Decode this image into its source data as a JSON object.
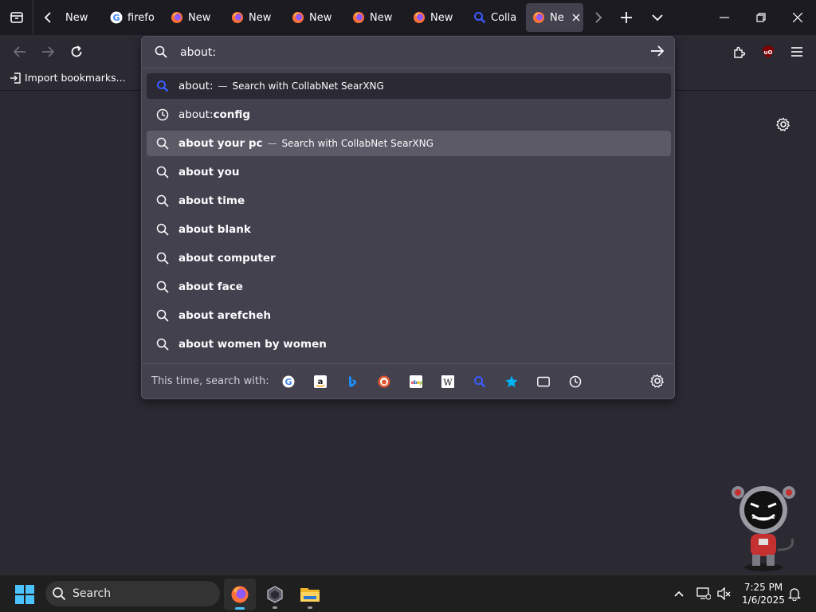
{
  "tabs": [
    {
      "label": "New",
      "icon": "firefox-icon"
    },
    {
      "label": "firefo",
      "icon": "google-icon"
    },
    {
      "label": "New",
      "icon": "firefox-icon"
    },
    {
      "label": "New",
      "icon": "firefox-icon"
    },
    {
      "label": "New",
      "icon": "firefox-icon"
    },
    {
      "label": "New",
      "icon": "firefox-icon"
    },
    {
      "label": "New",
      "icon": "firefox-icon"
    },
    {
      "label": "Colla",
      "icon": "search-icon"
    },
    {
      "label": "Ne",
      "icon": "firefox-icon",
      "active": true
    }
  ],
  "urlbar": {
    "value": "about:"
  },
  "bookmarks": {
    "import_label": "Import bookmarks..."
  },
  "suggestions": [
    {
      "type": "search-engine",
      "prefix": "about:",
      "sep": "—",
      "action": "Search with CollabNet SearXNG"
    },
    {
      "type": "history",
      "prefix": "about:",
      "bold": "config"
    },
    {
      "type": "search",
      "bold": "about your pc",
      "sep": "—",
      "action": "Search with CollabNet SearXNG",
      "selected": true
    },
    {
      "type": "search",
      "bold": "about you"
    },
    {
      "type": "search",
      "bold": "about time"
    },
    {
      "type": "search",
      "bold": "about blank"
    },
    {
      "type": "search",
      "bold": "about computer"
    },
    {
      "type": "search",
      "bold": "about face"
    },
    {
      "type": "search",
      "bold": "about arefcheh"
    },
    {
      "type": "search",
      "bold": "about women by women"
    }
  ],
  "oneoff": {
    "label": "This time, search with:",
    "engines": [
      "google-icon",
      "amazon-icon",
      "bing-icon",
      "duckduckgo-icon",
      "ebay-icon",
      "wikipedia-icon",
      "searxng-icon",
      "bookmarks-icon",
      "tabs-icon",
      "history-icon"
    ]
  },
  "taskbar": {
    "search_label": "Search",
    "time": "7:25 PM",
    "date": "1/6/2025"
  },
  "colors": {
    "accent": "#4cc2ff",
    "panel": "#42414d",
    "selected": "#5b5a66"
  }
}
